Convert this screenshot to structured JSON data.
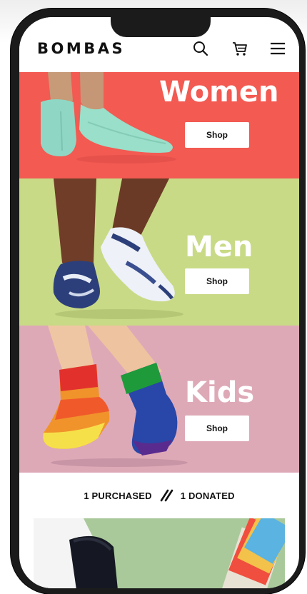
{
  "header": {
    "logo": "BOMBAS",
    "icons": [
      "search-icon",
      "cart-icon",
      "menu-icon"
    ]
  },
  "categories": [
    {
      "title": "Women",
      "button_label": "Shop",
      "color": "#f25a52"
    },
    {
      "title": "Men",
      "button_label": "Shop",
      "color": "#c8da86"
    },
    {
      "title": "Kids",
      "button_label": "Shop",
      "color": "#dea9b7"
    }
  ],
  "tagline": {
    "left": "1 PURCHASED",
    "right": "1 DONATED",
    "divider_icon": "double-slash-icon"
  },
  "promo": {
    "color": "#a9c99b"
  }
}
